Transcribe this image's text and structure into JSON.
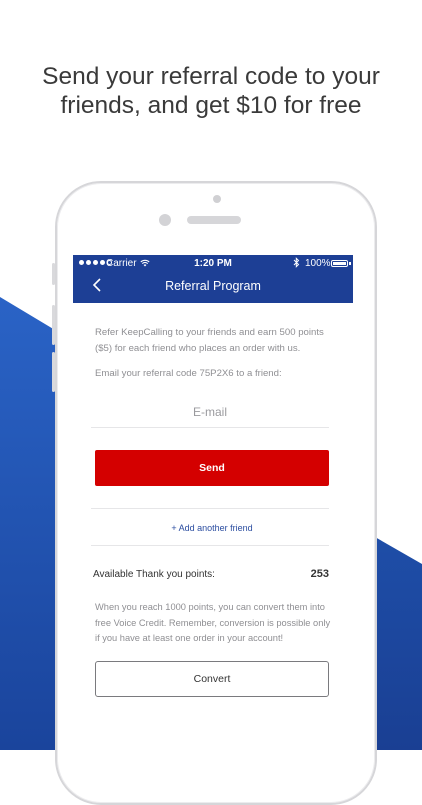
{
  "headline": {
    "line1": "Send your referral code to your",
    "line2": "friends, and get $10 for free"
  },
  "colors": {
    "brand_blue": "#1d3f95",
    "send_red": "#d40000",
    "bg_wedge_blue": "#1f56b8"
  },
  "status_bar": {
    "carrier": "Carrier",
    "wifi_icon": "wifi-icon",
    "time": "1:20 PM",
    "bluetooth_icon": "bluetooth-icon",
    "battery": "100%"
  },
  "navbar": {
    "back_icon": "chevron-left-icon",
    "title": "Referral Program"
  },
  "referral": {
    "intro": "Refer KeepCalling to your friends and earn 500 points ($5) for each friend who places an order with us.",
    "email_prompt": "Email your referral code 75P2X6 to a friend:",
    "email_placeholder": "E-mail",
    "send_label": "Send",
    "add_friend_label": "+ Add another friend"
  },
  "points": {
    "label": "Available Thank you points:",
    "value": "253"
  },
  "convert": {
    "note": "When you reach 1000 points, you can convert them into free Voice Credit. Remember, conversion is possible only if you have at least one order in your account!",
    "button_label": "Convert"
  }
}
